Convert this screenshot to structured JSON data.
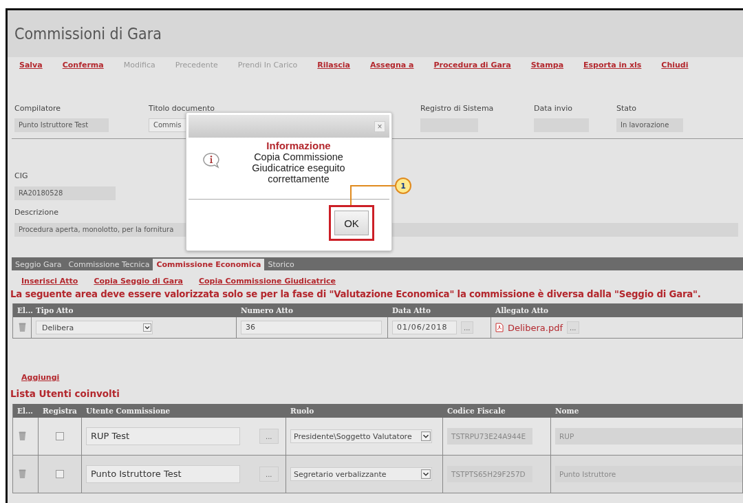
{
  "window": {
    "title": "Commissioni di Gara"
  },
  "toolbar": [
    {
      "label": "Salva",
      "disabled": false
    },
    {
      "label": "Conferma",
      "disabled": false
    },
    {
      "label": "Modifica",
      "disabled": true
    },
    {
      "label": "Precedente",
      "disabled": true
    },
    {
      "label": "Prendi In Carico",
      "disabled": true
    },
    {
      "label": "Rilascia",
      "disabled": false
    },
    {
      "label": "Assegna a",
      "disabled": false
    },
    {
      "label": "Procedura di Gara",
      "disabled": false
    },
    {
      "label": "Stampa",
      "disabled": false
    },
    {
      "label": "Esporta in xls",
      "disabled": false
    },
    {
      "label": "Chiudi",
      "disabled": false
    }
  ],
  "header_fields": [
    {
      "label": "Compilatore",
      "value": "Punto Istruttore Test"
    },
    {
      "label": "Titolo documento",
      "value": "Commis"
    },
    {
      "label": "Registro di Sistema"
    },
    {
      "label": "Data invio"
    },
    {
      "label": "Stato",
      "value": "In lavorazione"
    }
  ],
  "cig": {
    "label": "CIG",
    "value": "RA20180528"
  },
  "descrizione": {
    "label": "Descrizione",
    "value": "Procedura aperta, monolotto, per la fornitura"
  },
  "tabs": [
    {
      "label": "Seggio Gara",
      "selected": false
    },
    {
      "label": "Commissione Tecnica",
      "selected": false
    },
    {
      "label": "Commissione Economica",
      "selected": true
    },
    {
      "label": "Storico",
      "selected": false
    }
  ],
  "actions": [
    "Inserisci Atto",
    "Copia Seggio di Gara",
    "Copia Commissione Giudicatrice"
  ],
  "notice": "La seguente area deve essere valorizzata solo se per la fase di \"Valutazione Economica\" la commissione è diversa dalla \"Seggio di Gara\".",
  "atti_table": {
    "columns": [
      "El...",
      "Tipo Atto",
      "Numero Atto",
      "Data Atto",
      "Allegato Atto"
    ],
    "rows": [
      {
        "tipo": "Delibera",
        "numero": "36",
        "data": "01/06/2018",
        "date_button": "...",
        "allegato": "Delibera.pdf",
        "file_button": "..."
      }
    ]
  },
  "add_link": "Aggiungi",
  "users_title": "Lista Utenti coinvolti",
  "users_table": {
    "columns": [
      "El...",
      "Registra",
      "Utente Commissione",
      "Ruolo",
      "Codice Fiscale",
      "Nome"
    ],
    "rows": [
      {
        "checked": false,
        "utente": "RUP Test",
        "pick_button": "...",
        "ruolo": "Presidente\\Soggetto Valutatore",
        "codice_fiscale": "TSTRPU73E24A944E",
        "nome": "RUP"
      },
      {
        "checked": false,
        "utente": "Punto Istruttore Test",
        "pick_button": "...",
        "ruolo": "Segretario verbalizzante",
        "codice_fiscale": "TSTPTS65H29F257D",
        "nome": "Punto Istruttore"
      }
    ]
  },
  "dialog": {
    "title": "Informazione",
    "message": "Copia Commissione Giudicatrice eseguito correttamente",
    "close": "×",
    "ok": "OK",
    "callout": "1"
  }
}
